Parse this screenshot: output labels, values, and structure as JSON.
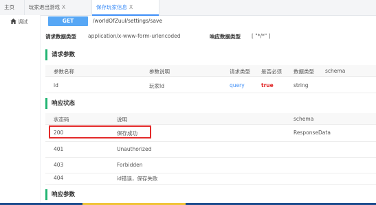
{
  "tabs": [
    {
      "label": "主页",
      "closable": false
    },
    {
      "label": "玩家退出游戏",
      "closable": true
    },
    {
      "label": "保存玩家信息",
      "closable": true,
      "active": true
    }
  ],
  "close_glyph": "X",
  "sidebar": {
    "items": [
      {
        "label": "调试",
        "icon": "home-icon"
      }
    ]
  },
  "endpoint": {
    "method": "GET",
    "path": "/worldOfZuul/settings/save"
  },
  "meta": {
    "request_type_label": "请求数据类型",
    "request_type_value": "application/x-www-form-urlencoded",
    "response_type_label": "响应数据类型",
    "response_type_value": "[ \"*/*\" ]"
  },
  "request_params": {
    "title": "请求参数",
    "columns": [
      "参数名称",
      "参数说明",
      "请求类型",
      "是否必须",
      "数据类型",
      "schema"
    ],
    "rows": [
      {
        "name": "id",
        "desc": "玩家Id",
        "in": "query",
        "required": "true",
        "type": "string",
        "schema": ""
      }
    ]
  },
  "response_status": {
    "title": "响应状态",
    "columns": [
      "状态码",
      "说明",
      "schema"
    ],
    "rows": [
      {
        "code": "200",
        "desc": "保存成功",
        "schema": "ResponseData"
      },
      {
        "code": "401",
        "desc": "Unauthorized",
        "schema": ""
      },
      {
        "code": "403",
        "desc": "Forbidden",
        "schema": ""
      },
      {
        "code": "404",
        "desc": "id错误，保存失败",
        "schema": ""
      }
    ]
  },
  "response_params": {
    "title": "响应参数"
  },
  "colors": {
    "accent": "#3e8ef7",
    "method_bg": "#57a7f5",
    "section_bar": "#22b573",
    "required": "#e02020",
    "highlight": "#e32929"
  }
}
